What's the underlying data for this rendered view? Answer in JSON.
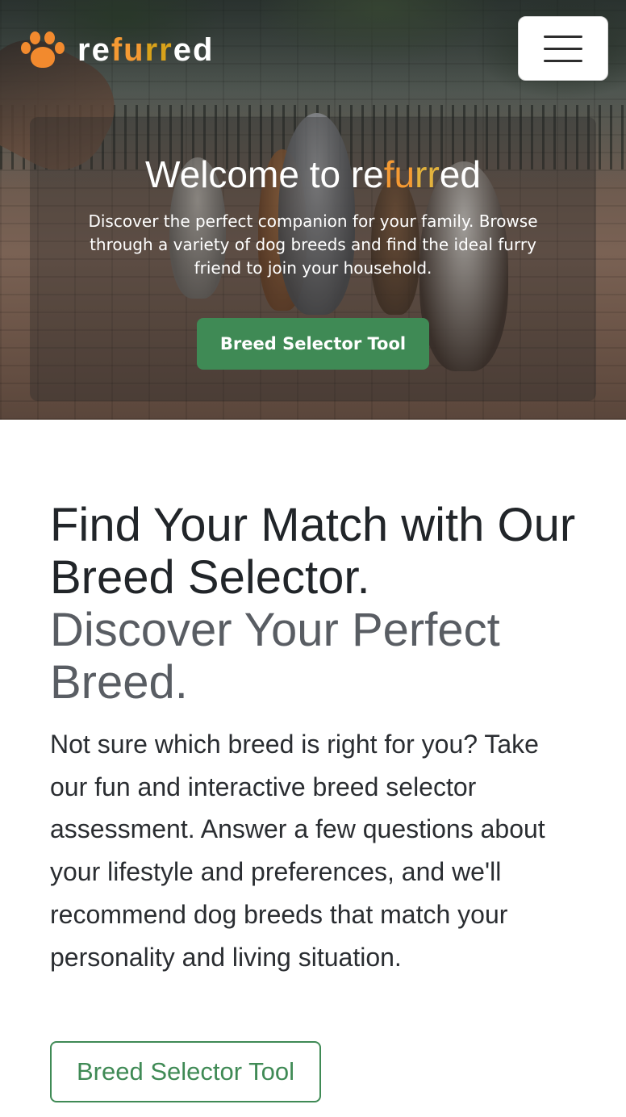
{
  "navbar": {
    "brand_parts": [
      "re",
      "f",
      "u",
      "rr",
      "ed"
    ],
    "menu_icon": "hamburger-menu-icon",
    "logo_icon": "paw-icon",
    "brand_colors": {
      "white": "#ffffff",
      "orange": "#f59a33",
      "gold": "#d9a21a"
    }
  },
  "hero": {
    "title_parts": [
      "Welcome to re",
      "fu",
      "rr",
      "ed"
    ],
    "text": "Discover the perfect companion for your family. Browse through a variety of dog breeds and find the ideal furry friend to join your household.",
    "button_label": "Breed Selector Tool",
    "button_color": "#3f8a55"
  },
  "main": {
    "heading": "Find Your Match with Our Breed Selector.",
    "subheading": "Discover Your Perfect Breed.",
    "description": "Not sure which breed is right for you? Take our fun and interactive breed selector assessment. Answer a few questions about your lifestyle and preferences, and we'll recommend dog breeds that match your personality and living situation.",
    "button_label": "Breed Selector Tool"
  }
}
